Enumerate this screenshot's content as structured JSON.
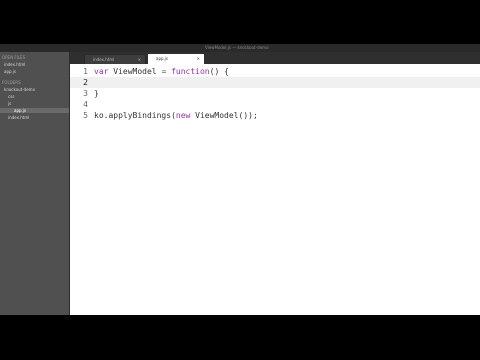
{
  "window": {
    "title": "ViewModel.js — knockout-demo"
  },
  "sidebar": {
    "rows": [
      {
        "label": "OPEN FILES",
        "header": true
      },
      {
        "label": "index.html",
        "header": false
      },
      {
        "label": "app.js",
        "header": false
      },
      {
        "label": "FOLDERS",
        "header": true
      },
      {
        "label": "knockout-demo",
        "header": false
      },
      {
        "label": "css",
        "header": false
      },
      {
        "label": "js",
        "header": false
      },
      {
        "label": "app.js",
        "header": false,
        "selected": true
      },
      {
        "label": "index.html",
        "header": false
      }
    ]
  },
  "tabs": [
    {
      "label": "index.html",
      "active": false,
      "close": "×"
    },
    {
      "label": "app.js",
      "active": true,
      "close": "×"
    }
  ],
  "editor": {
    "line_numbers": [
      "1",
      "2",
      "3",
      "4",
      "5"
    ],
    "lines": {
      "l1": {
        "kw": "var",
        "name": " ViewModel ",
        "op": "=",
        "fn": " function",
        "rest": "() {"
      },
      "l2": {
        "text": ""
      },
      "l3": {
        "text": "}"
      },
      "l4": {
        "text": ""
      },
      "l5": {
        "pre": "ko.applyBindings(",
        "kw": "new",
        "post": " ViewModel());"
      }
    }
  }
}
